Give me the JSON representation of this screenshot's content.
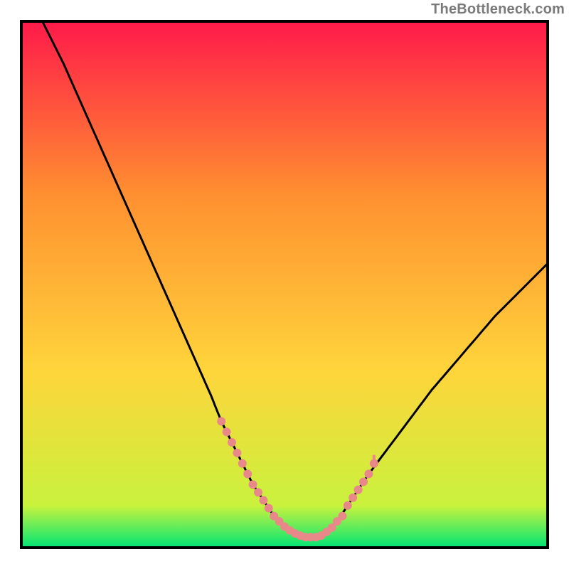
{
  "watermark": "TheBottleneck.com",
  "chart_data": {
    "type": "line",
    "title": "",
    "xlabel": "",
    "ylabel": "",
    "x_range": [
      0,
      100
    ],
    "y_range": [
      0,
      100
    ],
    "background_gradient": {
      "top_color": "#ff1a4a",
      "mid_color": "#ffd43b",
      "bottom_color": "#00e676"
    },
    "series": [
      {
        "name": "curve",
        "color": "#000000",
        "x": [
          4,
          8,
          12,
          16,
          20,
          24,
          28,
          32,
          36,
          38,
          40,
          42,
          44,
          46,
          48,
          50,
          52,
          54,
          56,
          58,
          60,
          62,
          66,
          72,
          78,
          84,
          90,
          96,
          100
        ],
        "values": [
          100,
          92,
          83,
          74,
          65,
          56,
          47,
          38,
          29,
          24,
          20,
          16,
          12,
          9,
          6,
          4,
          3,
          2,
          2,
          3,
          5,
          8,
          14,
          22,
          30,
          37,
          44,
          50,
          54
        ]
      },
      {
        "name": "highlight-dots-left",
        "color": "#e98888",
        "x": [
          38,
          39,
          40,
          41,
          42,
          43,
          44,
          45,
          46,
          47,
          48,
          49,
          50,
          51,
          52,
          53,
          54,
          55,
          56,
          57,
          58,
          59
        ],
        "values": [
          24,
          22,
          20,
          18,
          16,
          14,
          12,
          10.5,
          9,
          7.5,
          6,
          5,
          4,
          3.3,
          2.7,
          2.3,
          2,
          2,
          2,
          2.3,
          3,
          3.8
        ]
      },
      {
        "name": "highlight-dots-right",
        "color": "#e98888",
        "x": [
          60,
          61,
          62,
          63,
          64,
          65,
          66,
          67
        ],
        "values": [
          5,
          6,
          8,
          9.5,
          11,
          12.5,
          14,
          16
        ]
      }
    ],
    "axis_ticks": {
      "x": [],
      "y": []
    }
  }
}
